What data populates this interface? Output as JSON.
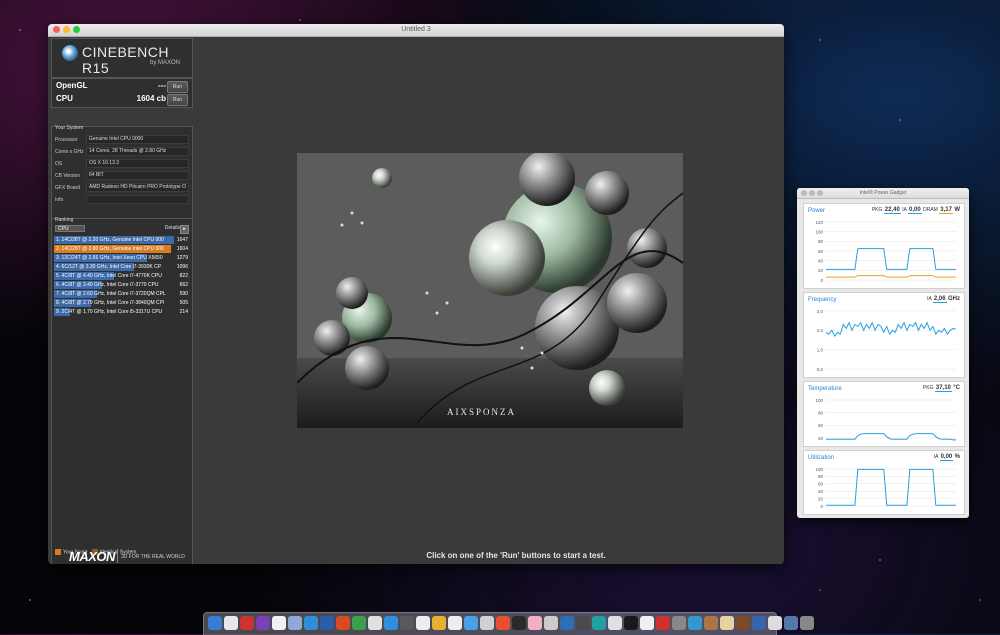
{
  "cinebench": {
    "window_title": "Untitled 3",
    "logo_title": "CINEBENCH R15",
    "logo_sub": "by MAXON",
    "tests": [
      {
        "label": "OpenGL",
        "value": "---",
        "run_label": "Run"
      },
      {
        "label": "CPU",
        "value": "1604 cb",
        "run_label": "Run"
      }
    ],
    "system": {
      "header": "Your System",
      "rows": [
        {
          "key": "Processor",
          "value": "Genuine Intel CPU 0000"
        },
        {
          "key": "Cores x GHz",
          "value": "14 Cores, 28 Threads @ 2.80 GHz"
        },
        {
          "key": "OS",
          "value": "OS X 10.13.3"
        },
        {
          "key": "CB Version",
          "value": "64 BIT"
        },
        {
          "key": "GFX Board",
          "value": "AMD Radeon HD Pitcairn PRO Prototype O"
        },
        {
          "key": "Info",
          "value": ""
        }
      ]
    },
    "ranking": {
      "header": "Ranking",
      "selected": "CPU",
      "details_label": "Details",
      "rows": [
        {
          "text": "1. 14C/28T @ 2.20 GHz, Genuine Intel CPU 000",
          "score": "1647",
          "fill": 1.0,
          "mine": false
        },
        {
          "text": "2. 14C/28T @ 2.80 GHz, Genuine Intel CPU 000",
          "score": "1604",
          "fill": 0.974,
          "mine": true
        },
        {
          "text": "3. 12C/24T @ 2.66 GHz, Intel Xeon CPU X5650",
          "score": "1279",
          "fill": 0.777,
          "mine": false
        },
        {
          "text": "4. 6C/12T @ 3.30 GHz, Intel Core i7-3930K CP",
          "score": "1096",
          "fill": 0.665,
          "mine": false
        },
        {
          "text": "5. 4C/8T @ 4.40 GHz, Intel Core i7-4770K CPU",
          "score": "822",
          "fill": 0.499,
          "mine": false
        },
        {
          "text": "6. 4C/8T @ 3.40 GHz, Intel Core i7-3770 CPU",
          "score": "662",
          "fill": 0.402,
          "mine": false
        },
        {
          "text": "7. 4C/8T @ 2.60 GHz, Intel Core i7-3720QM CPL",
          "score": "590",
          "fill": 0.358,
          "mine": false
        },
        {
          "text": "8. 4C/8T @ 2.79 GHz, Intel Core i7-3840QM CPI",
          "score": "505",
          "fill": 0.307,
          "mine": false
        },
        {
          "text": "9. 2C/4T @ 1.70 GHz, Intel Core i5-3317U CPU",
          "score": "214",
          "fill": 0.13,
          "mine": false
        }
      ],
      "legend": [
        {
          "label": "Your Score",
          "color": "#d87d20"
        },
        {
          "label": "Identical System",
          "color": "#8a5a2a"
        }
      ]
    },
    "brand": "MAXON",
    "brand_tag": "3D FOR THE REAL WORLD",
    "render_watermark": "AIXSPONZA",
    "status_message": "Click on one of the 'Run' buttons to start a test."
  },
  "power_gadget": {
    "window_title": "Intel® Power Gadget",
    "panels": [
      {
        "title": "Power",
        "readouts": [
          {
            "label": "PKG",
            "value": "22,40",
            "style": "blue"
          },
          {
            "label": "IA",
            "value": "0,00",
            "style": "blue"
          },
          {
            "label": "DRAM",
            "value": "3,17",
            "style": "orange"
          }
        ],
        "unit": "W",
        "yticks": [
          "120",
          "100",
          "80",
          "60",
          "40",
          "20",
          "0"
        ],
        "ymax": 120,
        "series": [
          {
            "color": "#2b9fe0",
            "values": [
              22,
              22,
              22,
              22,
              22,
              22,
              22,
              22,
              22,
              22,
              22,
              65,
              65,
              65,
              65,
              65,
              65,
              65,
              65,
              65,
              65,
              22,
              22,
              22,
              22,
              22,
              22,
              22,
              22,
              65,
              65,
              65,
              65,
              65,
              65,
              65,
              65,
              65,
              22,
              22,
              22,
              22,
              22,
              22,
              22,
              22
            ]
          },
          {
            "color": "#f0a020",
            "values": [
              6,
              6,
              6,
              6,
              6,
              6,
              6,
              6,
              6,
              6,
              6,
              9,
              9,
              9,
              9,
              9,
              9,
              9,
              9,
              9,
              9,
              6,
              6,
              6,
              6,
              6,
              6,
              6,
              6,
              9,
              9,
              9,
              9,
              9,
              9,
              9,
              9,
              9,
              6,
              6,
              6,
              6,
              6,
              6,
              6,
              6
            ]
          }
        ]
      },
      {
        "title": "Frequency",
        "readouts": [
          {
            "label": "IA",
            "value": "2,06",
            "style": "blue"
          }
        ],
        "unit": "GHz",
        "yticks": [
          "3,0",
          "2,0",
          "1,0",
          "0,0"
        ],
        "ymax": 3,
        "series": [
          {
            "color": "#2b9fe0",
            "values": [
              1.9,
              1.8,
              2.0,
              1.7,
              1.9,
              1.8,
              2.3,
              2.1,
              2.4,
              2.0,
              2.3,
              2.2,
              2.4,
              2.0,
              2.3,
              2.1,
              2.4,
              2.0,
              2.3,
              2.2,
              1.9,
              2.2,
              1.8,
              2.0,
              1.9,
              2.3,
              2.1,
              2.4,
              2.0,
              2.3,
              2.2,
              2.4,
              2.0,
              2.3,
              2.1,
              2.4,
              2.0,
              2.2,
              1.8,
              2.0,
              1.9,
              2.1,
              1.8,
              2.0,
              2.1,
              2.06
            ]
          }
        ]
      },
      {
        "title": "Temperature",
        "readouts": [
          {
            "label": "PKG",
            "value": "37,10",
            "style": "blue"
          }
        ],
        "unit": "°C",
        "yticks": [
          "100",
          "80",
          "60",
          "40"
        ],
        "ymax": 100,
        "series": [
          {
            "color": "#2b9fe0",
            "values": [
              38,
              38,
              38,
              38,
              38,
              38,
              38,
              38,
              38,
              38,
              38,
              44,
              46,
              47,
              47,
              47,
              47,
              47,
              47,
              47,
              47,
              42,
              39,
              38,
              38,
              38,
              38,
              38,
              38,
              44,
              46,
              47,
              47,
              47,
              47,
              47,
              47,
              47,
              42,
              39,
              38,
              38,
              38,
              38,
              37,
              37
            ]
          }
        ]
      },
      {
        "title": "Utilization",
        "readouts": [
          {
            "label": "IA",
            "value": "0,00",
            "style": "blue"
          }
        ],
        "unit": "%",
        "yticks": [
          "100",
          "80",
          "60",
          "40",
          "20",
          "0"
        ],
        "ymax": 100,
        "series": [
          {
            "color": "#2b9fe0",
            "values": [
              2,
              2,
              2,
              2,
              2,
              2,
              2,
              2,
              2,
              2,
              2,
              99,
              99,
              99,
              99,
              99,
              99,
              99,
              99,
              99,
              99,
              2,
              2,
              2,
              2,
              2,
              2,
              2,
              2,
              99,
              99,
              99,
              99,
              99,
              99,
              99,
              99,
              99,
              2,
              2,
              2,
              2,
              2,
              2,
              2,
              2
            ]
          }
        ]
      }
    ]
  },
  "dock": {
    "colors": [
      "#3a7bd5",
      "#e8e8e8",
      "#c33",
      "#7b3fb8",
      "#f0f0f0",
      "#8fa8d8",
      "#2e8fd8",
      "#2a5caa",
      "#d84a20",
      "#3aa050",
      "#e0e0e0",
      "#2d8fe0",
      "#5a5a5a",
      "#ededed",
      "#e8b030",
      "#eeeeee",
      "#4aa0e8",
      "#d0d0d0",
      "#e85030",
      "#2a2a2a",
      "#f2b0c0",
      "#cccccc",
      "#2c6fb8",
      "#4a4a4a",
      "#20a0a0",
      "#e0e0e0",
      "#1a1a1a",
      "#f0f0f0",
      "#d03030",
      "#888888",
      "#3399cc",
      "#aa7744",
      "#e8d0a0",
      "#7a4a2a",
      "#3366aa",
      "#dddddd",
      "#5577aa",
      "#888888"
    ]
  }
}
